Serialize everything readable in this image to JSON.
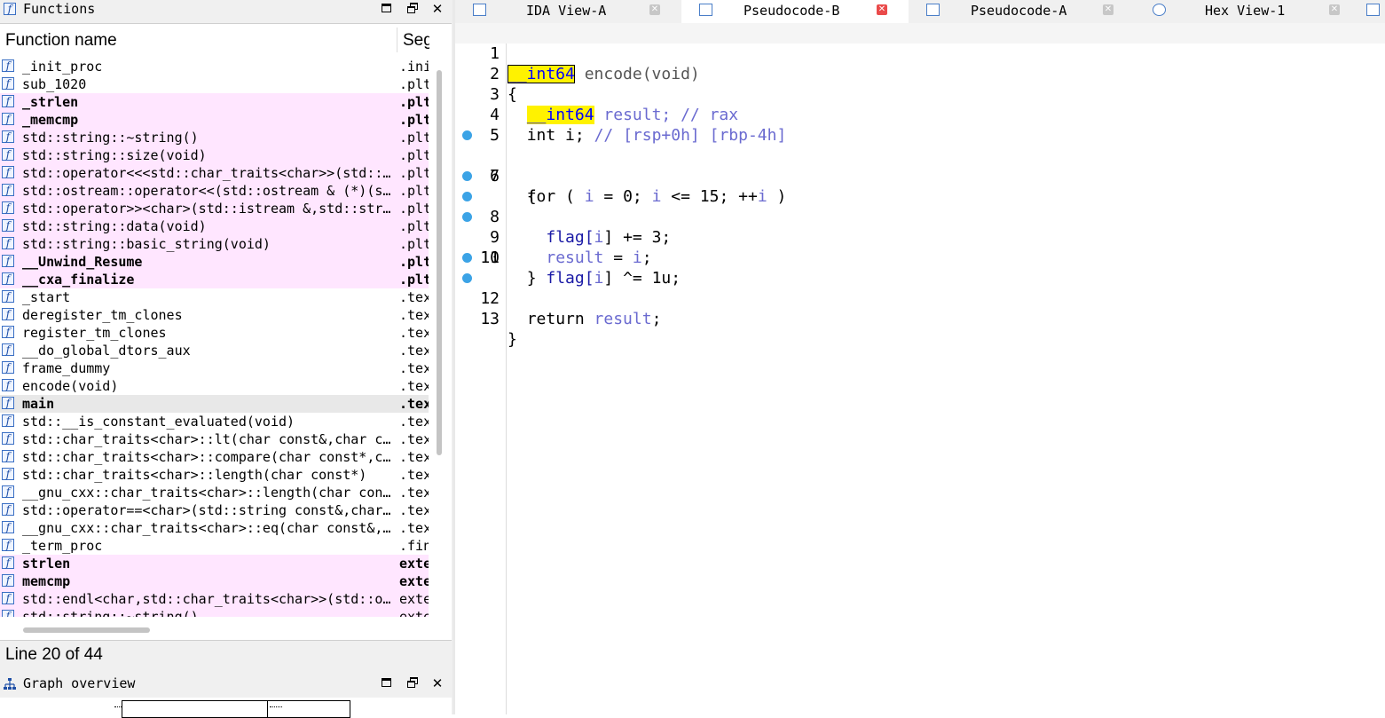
{
  "functions_panel": {
    "title": "Functions",
    "col_name": "Function name",
    "col_seg": "Segment",
    "rows": [
      {
        "name": "_init_proc",
        "seg": ".init",
        "style": "normal"
      },
      {
        "name": "sub_1020",
        "seg": ".plt",
        "style": "normal"
      },
      {
        "name": "_strlen",
        "seg": ".plt",
        "style": "pink-bold"
      },
      {
        "name": "_memcmp",
        "seg": ".plt",
        "style": "pink-bold"
      },
      {
        "name": "std::string::~string()",
        "seg": ".plt",
        "style": "pink"
      },
      {
        "name": "std::string::size(void)",
        "seg": ".plt",
        "style": "pink"
      },
      {
        "name": "std::operator<<<std::char_traits<char>>(std::ostream &,char const*)",
        "seg": ".plt",
        "style": "pink"
      },
      {
        "name": "std::ostream::operator<<(std::ostream & (*)(std::ostream &))",
        "seg": ".plt",
        "style": "pink"
      },
      {
        "name": "std::operator>><char>(std::istream &,std::string &)",
        "seg": ".plt",
        "style": "pink"
      },
      {
        "name": "std::string::data(void)",
        "seg": ".plt",
        "style": "pink"
      },
      {
        "name": "std::string::basic_string(void)",
        "seg": ".plt",
        "style": "pink"
      },
      {
        "name": "__Unwind_Resume",
        "seg": ".plt",
        "style": "pink-bold"
      },
      {
        "name": "__cxa_finalize",
        "seg": ".plt",
        "style": "pink-bold"
      },
      {
        "name": "_start",
        "seg": ".text",
        "style": "normal"
      },
      {
        "name": "deregister_tm_clones",
        "seg": ".text",
        "style": "normal"
      },
      {
        "name": "register_tm_clones",
        "seg": ".text",
        "style": "normal"
      },
      {
        "name": "__do_global_dtors_aux",
        "seg": ".text",
        "style": "normal"
      },
      {
        "name": "frame_dummy",
        "seg": ".text",
        "style": "normal"
      },
      {
        "name": "encode(void)",
        "seg": ".text",
        "style": "normal"
      },
      {
        "name": "main",
        "seg": ".text",
        "style": "selected-bold"
      },
      {
        "name": "std::__is_constant_evaluated(void)",
        "seg": ".text",
        "style": "normal"
      },
      {
        "name": "std::char_traits<char>::lt(char const&,char const&)",
        "seg": ".text",
        "style": "normal"
      },
      {
        "name": "std::char_traits<char>::compare(char const*,char const*,ulong)",
        "seg": ".text",
        "style": "normal"
      },
      {
        "name": "std::char_traits<char>::length(char const*)",
        "seg": ".text",
        "style": "normal"
      },
      {
        "name": "__gnu_cxx::char_traits<char>::length(char const*)",
        "seg": ".text",
        "style": "normal"
      },
      {
        "name": "std::operator==<char>(std::string const&,char const*)",
        "seg": ".text",
        "style": "normal"
      },
      {
        "name": "__gnu_cxx::char_traits<char>::eq(char const&,char const&)",
        "seg": ".text",
        "style": "normal"
      },
      {
        "name": "_term_proc",
        "seg": ".fini",
        "style": "normal"
      },
      {
        "name": "strlen",
        "seg": "extern",
        "style": "pink-bold"
      },
      {
        "name": "memcmp",
        "seg": "extern",
        "style": "pink-bold"
      },
      {
        "name": "std::endl<char,std::char_traits<char>>(std::ostream &)",
        "seg": "extern",
        "style": "pink"
      },
      {
        "name": "std::string::~string()",
        "seg": "extern",
        "style": "pink"
      }
    ],
    "status": "Line 20 of 44"
  },
  "graph_panel": {
    "title": "Graph overview"
  },
  "window_buttons": {
    "maximize": "maximize",
    "restore": "restore",
    "close": "✕"
  },
  "tabs": [
    {
      "label": "IDA View-A",
      "icon": "ida-view-icon",
      "active": false
    },
    {
      "label": "Pseudocode-B",
      "icon": "pseudocode-icon",
      "active": true
    },
    {
      "label": "Pseudocode-A",
      "icon": "pseudocode-icon",
      "active": false
    },
    {
      "label": "Hex View-1",
      "icon": "hex-view-icon",
      "active": false
    }
  ],
  "code": {
    "lines": [
      {
        "num": "1",
        "bp": false
      },
      {
        "num": "2",
        "bp": false
      },
      {
        "num": "3",
        "bp": false
      },
      {
        "num": "4",
        "bp": false
      },
      {
        "num": "5",
        "bp": false
      },
      {
        "num": "6",
        "bp": true
      },
      {
        "num": "7",
        "bp": false
      },
      {
        "num": "8",
        "bp": true
      },
      {
        "num": "9",
        "bp": true
      },
      {
        "num": "10",
        "bp": true
      },
      {
        "num": "11",
        "bp": false
      },
      {
        "num": "12",
        "bp": true
      },
      {
        "num": "13",
        "bp": true
      }
    ],
    "tokens": {
      "int64": "__int64",
      "func_sig": "encode(void)",
      "open_brace": "{",
      "close_brace": "}",
      "result_decl": "result; // rax",
      "i_decl_kw": "int i;",
      "i_decl_comment": "// [rsp+0h] [rbp-4h]",
      "for_kw": "for ( ",
      "for_i1": "i",
      "for_mid1": " = 0; ",
      "for_i2": "i",
      "for_mid2": " <= 15; ++",
      "for_i3": "i",
      "for_end": " )",
      "flag1_a": "flag[",
      "flag1_i": "i",
      "flag1_b": "] += 3;",
      "res_assign_a": "result",
      "res_assign_b": " = ",
      "res_assign_i": "i",
      "res_assign_c": ";",
      "flag2_a": "flag[",
      "flag2_i": "i",
      "flag2_b": "] ^= 1u;",
      "return_kw": "return ",
      "return_var": "result",
      "return_end": ";"
    }
  },
  "colors": {
    "pink_row": "#ffe6ff",
    "highlight": "#fff200",
    "breakpoint": "#3ba3e6",
    "variable": "#6a6ad0"
  }
}
